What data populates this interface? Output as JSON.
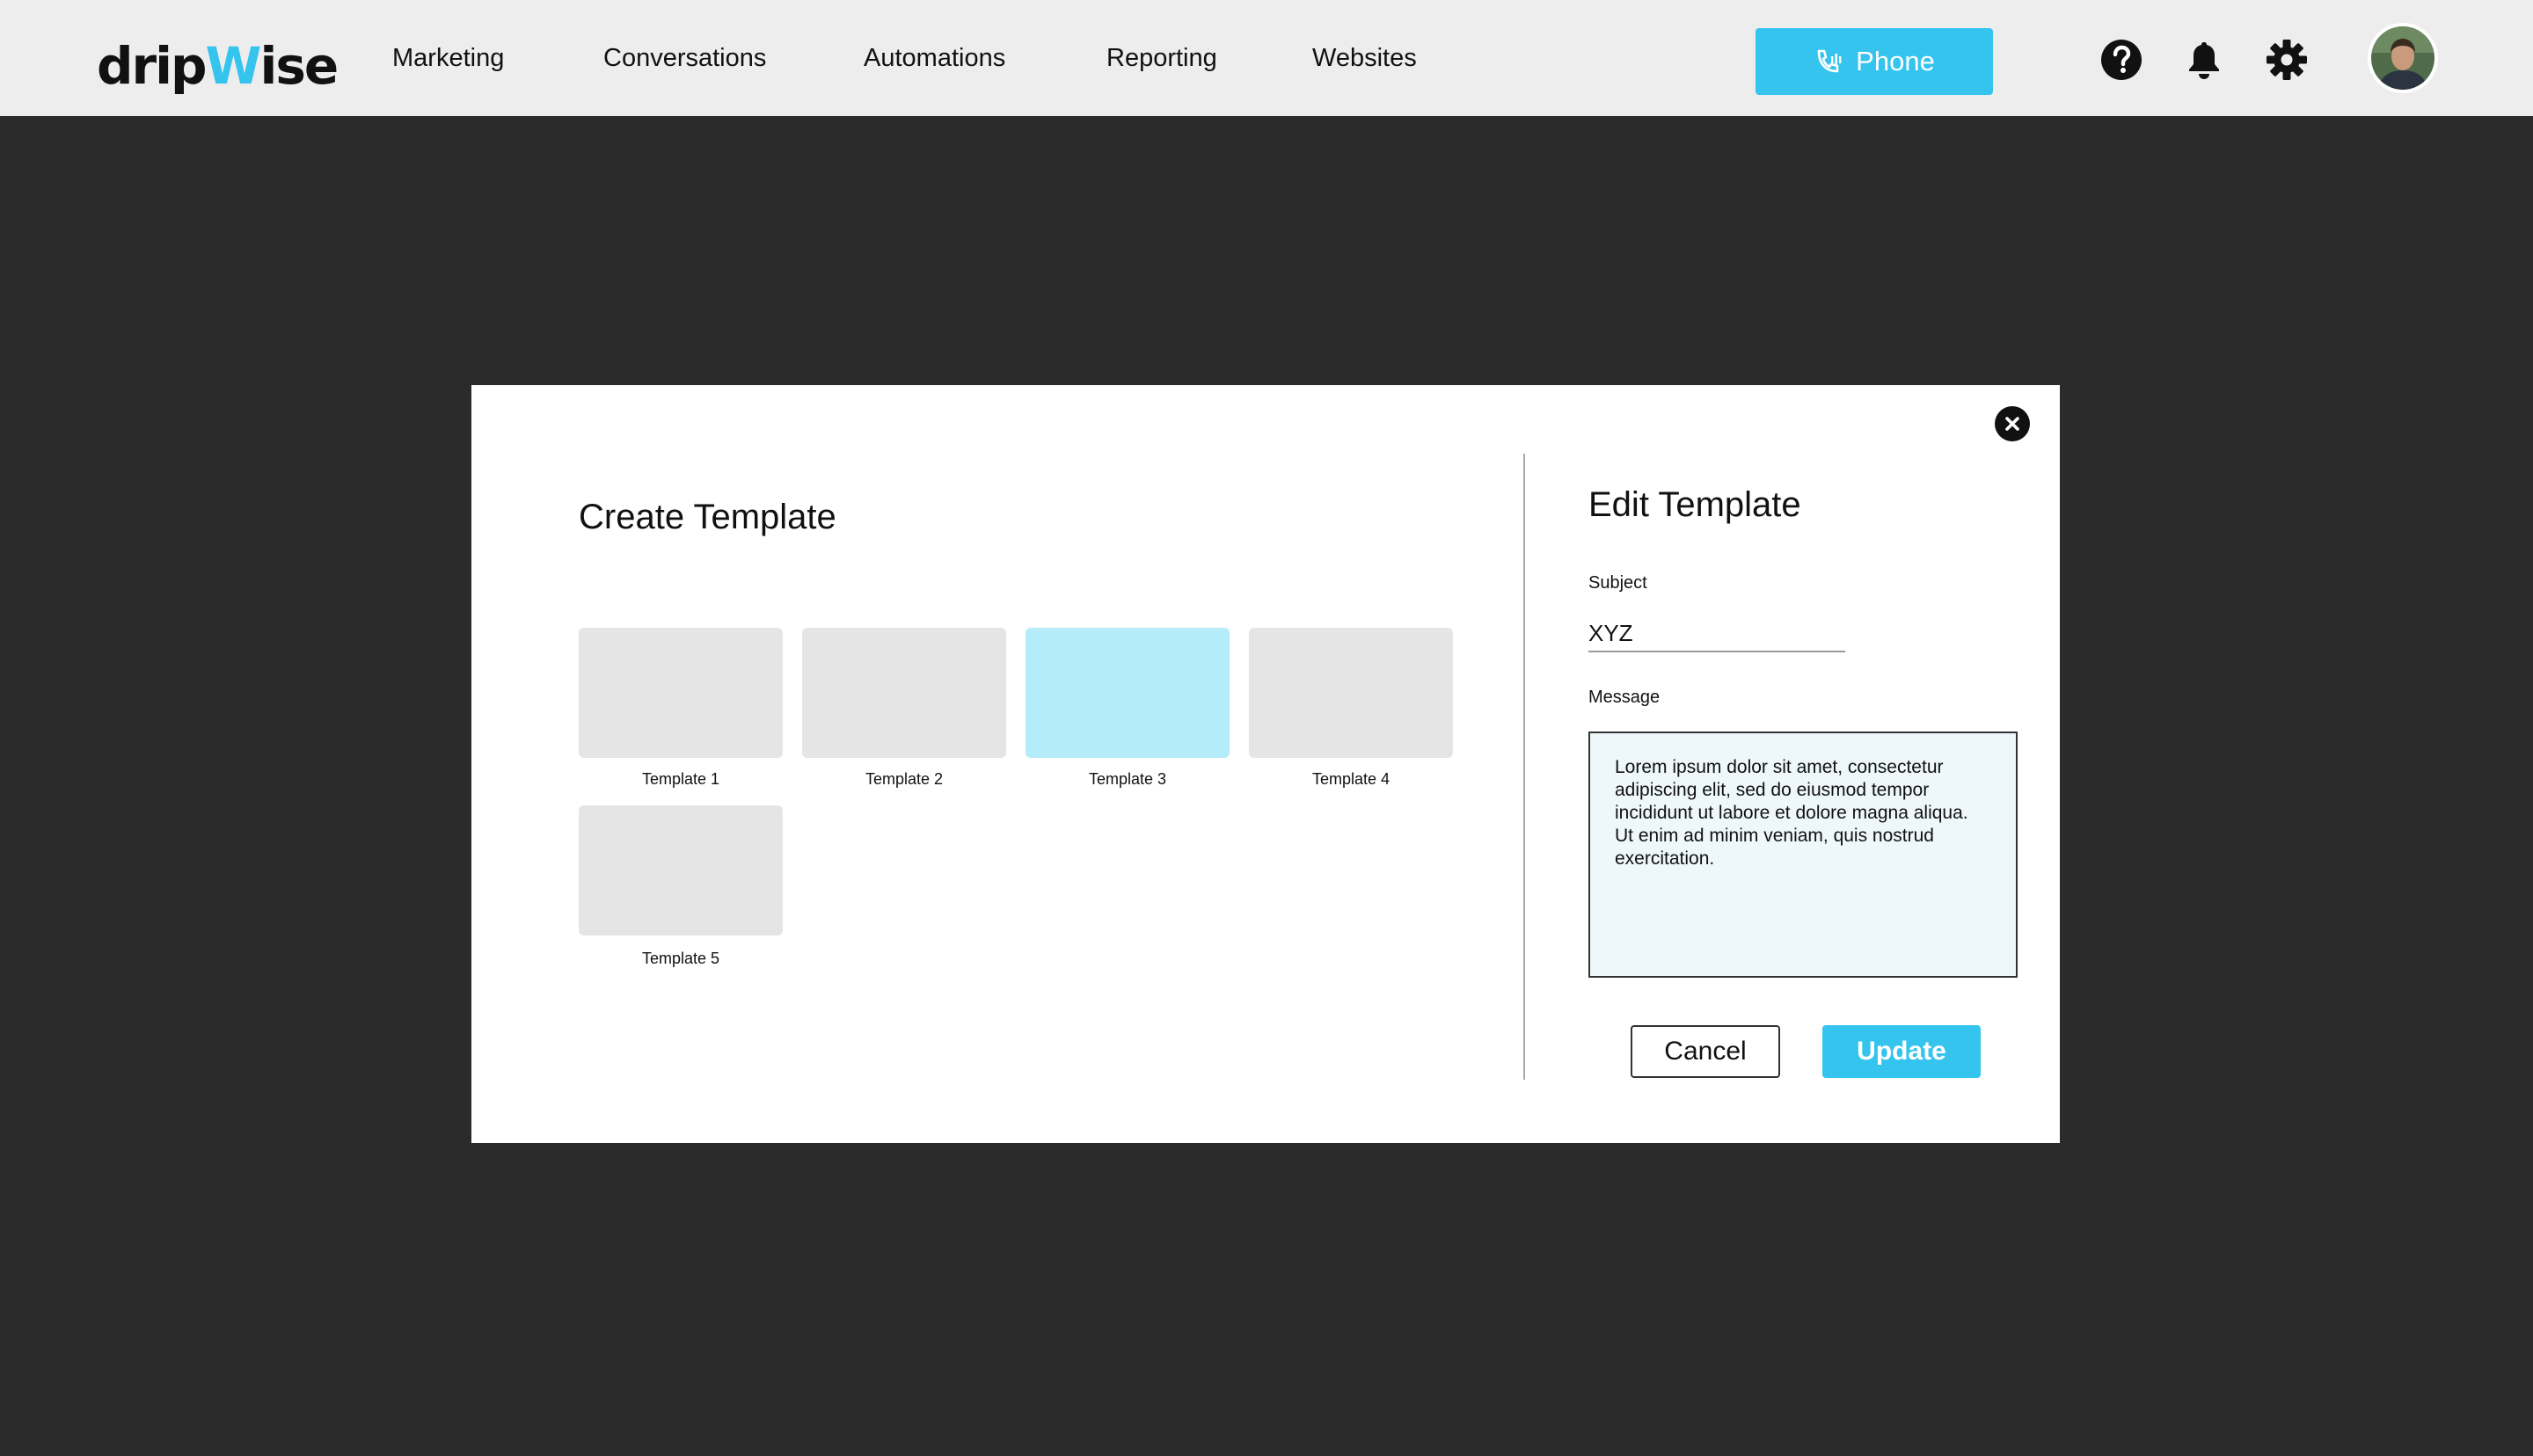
{
  "header": {
    "logo": {
      "part1": "drip",
      "part2": "W",
      "part3": "ise"
    },
    "nav": [
      "Marketing",
      "Conversations",
      "Automations",
      "Reporting",
      "Websites"
    ],
    "phone_label": "Phone",
    "icons": [
      "help-icon",
      "bell-icon",
      "gear-icon"
    ],
    "accent_color": "#35c4ee"
  },
  "create_template": {
    "title": "Create Template",
    "templates": [
      {
        "label": "Template 1",
        "selected": false
      },
      {
        "label": "Template 2",
        "selected": false
      },
      {
        "label": "Template 3",
        "selected": true
      },
      {
        "label": "Template 4",
        "selected": false
      },
      {
        "label": "Template 5",
        "selected": false
      }
    ]
  },
  "edit_template": {
    "title": "Edit Template",
    "subject_label": "Subject",
    "subject_value": "XYZ",
    "message_label": "Message",
    "message_value": "Lorem ipsum dolor sit amet, consectetur adipiscing elit, sed do eiusmod tempor incididunt ut labore et dolore magna aliqua. Ut enim ad minim veniam, quis nostrud exercitation.",
    "cancel_label": "Cancel",
    "update_label": "Update"
  }
}
